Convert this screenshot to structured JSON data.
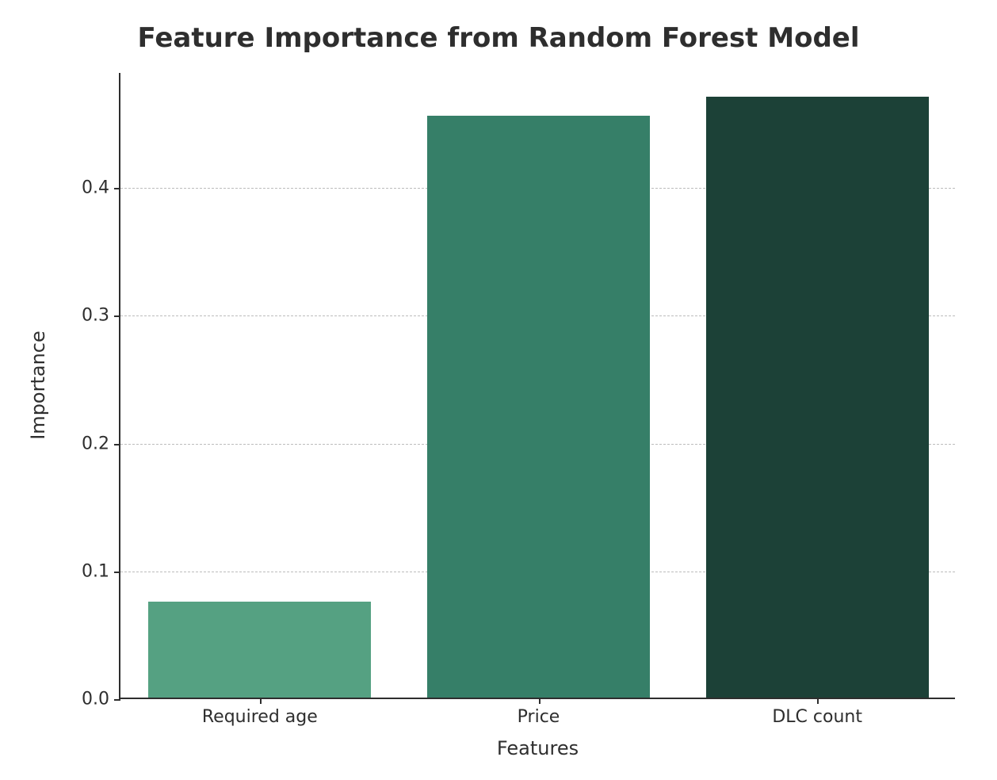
{
  "chart_data": {
    "type": "bar",
    "title": "Feature Importance from Random Forest Model",
    "xlabel": "Features",
    "ylabel": "Importance",
    "categories": [
      "Required age",
      "Price",
      "DLC count"
    ],
    "values": [
      0.075,
      0.455,
      0.47
    ],
    "colors": [
      "#55a182",
      "#367f68",
      "#1c4137"
    ],
    "ylim": [
      0.0,
      0.49
    ],
    "yticks": [
      0.0,
      0.1,
      0.2,
      0.3,
      0.4
    ],
    "ytick_labels": [
      "0.0",
      "0.1",
      "0.2",
      "0.3",
      "0.4"
    ]
  }
}
